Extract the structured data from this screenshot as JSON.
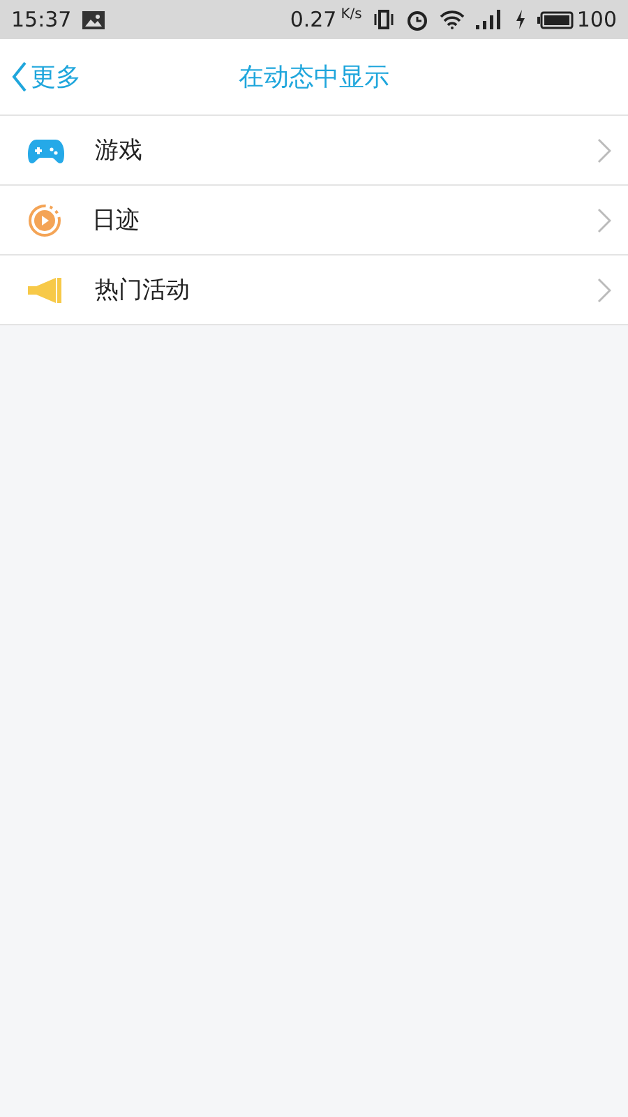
{
  "status_bar": {
    "time": "15:37",
    "speed": "0.27",
    "speed_unit": "K/s",
    "battery": "100"
  },
  "nav": {
    "back": "更多",
    "title": "在动态中显示"
  },
  "items": [
    {
      "kind": "game",
      "label": "游戏"
    },
    {
      "kind": "diary",
      "label": "日迹"
    },
    {
      "kind": "event",
      "label": "热门活动"
    }
  ]
}
